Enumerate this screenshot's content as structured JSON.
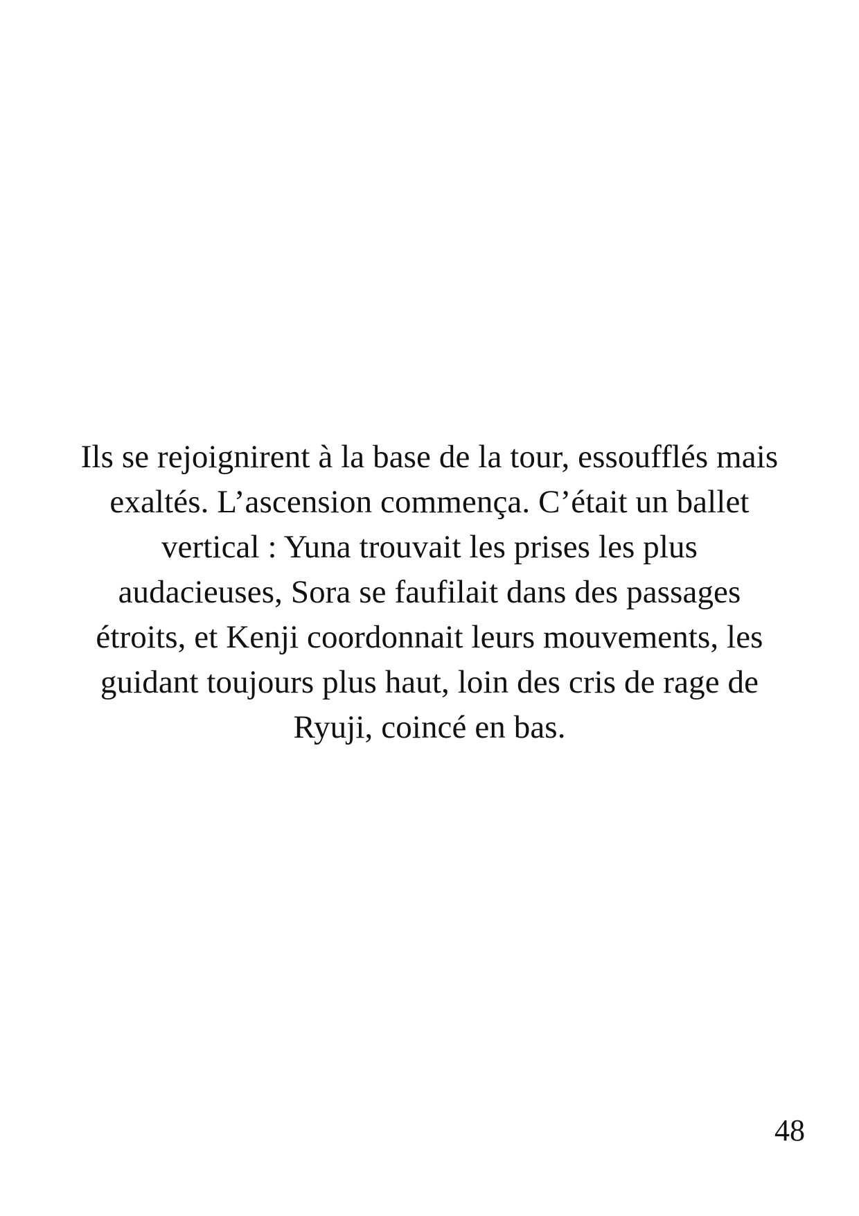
{
  "page": {
    "paragraph_lines": [
      "Ils se rejoignirent à la base de la tour, essoufflés mais",
      "exaltés. L’ascension commença. C’était un ballet",
      "vertical : Yuna trouvait les prises les plus",
      "audacieuses, Sora se faufilait dans des passages",
      "étroits, et Kenji coordonnait leurs mouvements, les",
      "guidant toujours plus haut, loin des cris de rage de",
      "Ryuji, coincé en bas."
    ],
    "page_number": "48"
  }
}
